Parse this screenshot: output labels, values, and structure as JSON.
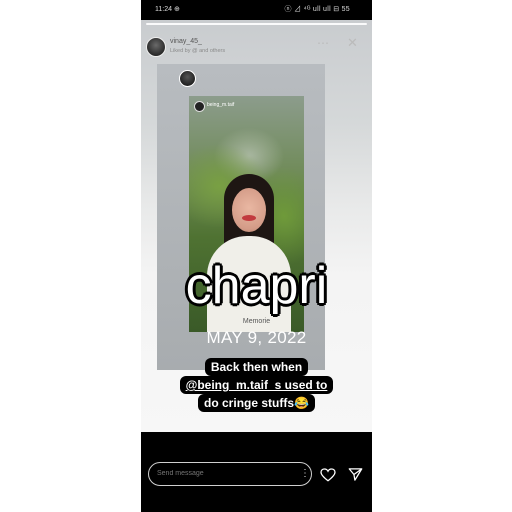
{
  "status_bar": {
    "time": "11:24 ⊕",
    "icons": "ⓝ ⊿ ⁴ᴳ ull ull ⊟ 55",
    "battery": "55%"
  },
  "story": {
    "username": "vinay_45_",
    "subtitle": "Liked by @ and others",
    "more_glyph": "⋯",
    "close_glyph": "✕",
    "inner_post_username": "being_m.taif",
    "big_word": "chapri",
    "memory_label": "Memorie",
    "date": "MAY 9, 2022",
    "caption_lines": [
      "Back then when",
      "@being_m.taif_s used to",
      "do cringe stuffs😂"
    ],
    "mention": "@being_m.taif_s"
  },
  "bottom_bar": {
    "message_placeholder": "Send message",
    "more_glyph": "⋮"
  },
  "colors": {
    "background": "#000000",
    "caption_bg": "#000000",
    "caption_text": "#ffffff"
  }
}
